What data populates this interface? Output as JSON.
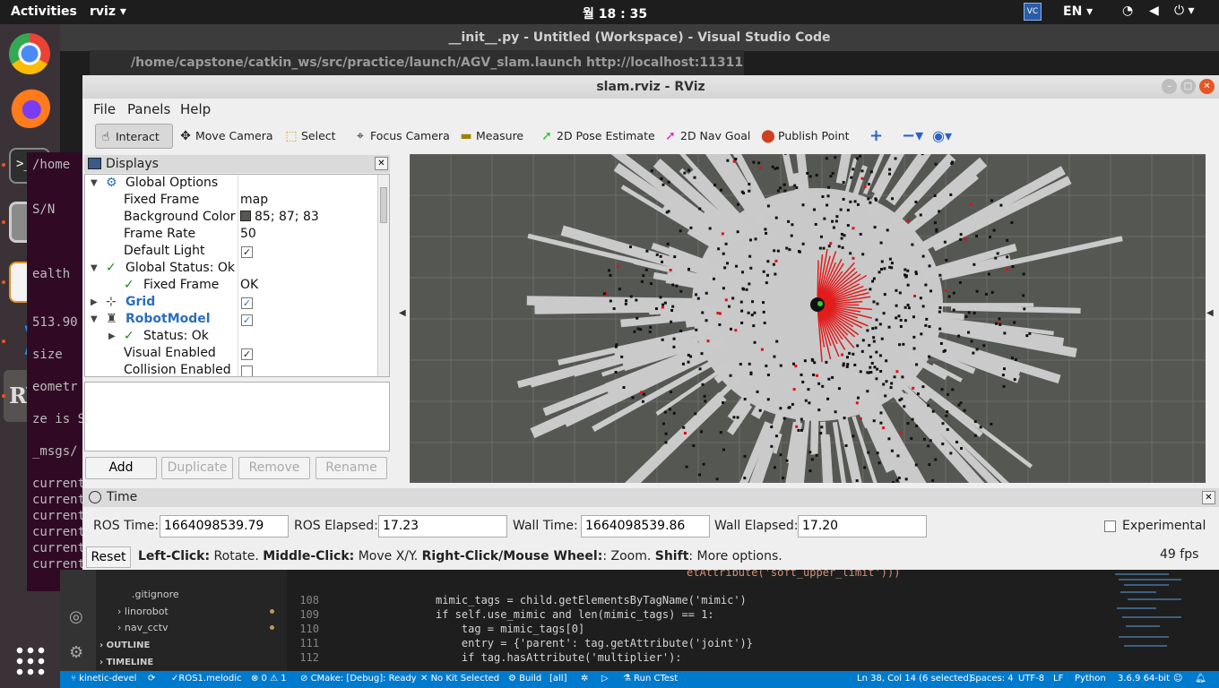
{
  "topbar": {
    "activities": "Activities",
    "app_menu": "rviz ▾",
    "clock": "월 18 : 35",
    "lang": "EN ▾"
  },
  "vscode": {
    "title": "__init__.py - Untitled (Workspace) - Visual Studio Code",
    "launch_window_title": "/home/capstone/catkin_ws/src/practice/launch/AGV_slam.launch http://localhost:11311",
    "terminal_lines": [
      "/home",
      "S/N",
      "ealth",
      "513.90",
      "size",
      "eometr",
      "ze is S",
      "_msgs/",
      "current",
      "current",
      "current",
      "current",
      "current",
      "current"
    ],
    "code_partial_top": "etAttribute('soft_upper_limit')))",
    "code_lines": [
      {
        "ln": "108",
        "text": "mimic_tags = child.getElementsByTagName('mimic')"
      },
      {
        "ln": "109",
        "text": "if self.use_mimic and len(mimic_tags) == 1:"
      },
      {
        "ln": "110",
        "text": "    tag = mimic_tags[0]"
      },
      {
        "ln": "111",
        "text": "    entry = {'parent': tag.getAttribute('joint')}"
      },
      {
        "ln": "112",
        "text": "    if tag.hasAttribute('multiplier'):"
      }
    ],
    "explorer": {
      "gitignore": ".gitignore",
      "linorobot": "linorobot",
      "nav_cctv": "nav_cctv",
      "outline": "OUTLINE",
      "timeline": "TIMELINE"
    },
    "status": {
      "branch": "kinetic-devel",
      "ros": "ROS1.melodic",
      "problems": "⊗ 0 ⚠ 1",
      "cmake": "CMake: [Debug]: Ready",
      "kit": "No Kit Selected",
      "build": "Build",
      "all": "[all]",
      "ctest": "Run CTest",
      "position": "Ln 38, Col 14 (6 selected)",
      "spaces": "Spaces: 4",
      "encoding": "UTF-8",
      "eol": "LF",
      "language": "Python",
      "interpreter": "3.6.9 64-bit"
    }
  },
  "rviz": {
    "title": "slam.rviz - RViz",
    "menu": {
      "file": "File",
      "panels": "Panels",
      "help": "Help"
    },
    "tools": {
      "interact": "Interact",
      "move_camera": "Move Camera",
      "select": "Select",
      "focus_camera": "Focus Camera",
      "measure": "Measure",
      "pose_estimate": "2D Pose Estimate",
      "nav_goal": "2D Nav Goal",
      "publish_point": "Publish Point"
    },
    "displays": {
      "title": "Displays",
      "rows": {
        "global_options": "Global Options",
        "fixed_frame": "Fixed Frame",
        "fixed_frame_val": "map",
        "bg_color": "Background Color",
        "bg_color_val": "85; 87; 83",
        "frame_rate": "Frame Rate",
        "frame_rate_val": "50",
        "default_light": "Default Light",
        "global_status": "Global Status: Ok",
        "status_fixed_frame": "Fixed Frame",
        "status_fixed_frame_val": "OK",
        "grid": "Grid",
        "robot_model": "RobotModel",
        "status_ok": "Status: Ok",
        "visual_enabled": "Visual Enabled",
        "collision_enabled": "Collision Enabled"
      },
      "buttons": {
        "add": "Add",
        "duplicate": "Duplicate",
        "remove": "Remove",
        "rename": "Rename"
      }
    },
    "background_color": "#555753",
    "time": {
      "title": "Time",
      "ros_time_label": "ROS Time:",
      "ros_time": "1664098539.79",
      "ros_elapsed_label": "ROS Elapsed:",
      "ros_elapsed": "17.23",
      "wall_time_label": "Wall Time:",
      "wall_time": "1664098539.86",
      "wall_elapsed_label": "Wall Elapsed:",
      "wall_elapsed": "17.20",
      "experimental": "Experimental",
      "reset": "Reset",
      "help_left_b": "Left-Click:",
      "help_left": " Rotate. ",
      "help_mid_b": "Middle-Click:",
      "help_mid": " Move X/Y. ",
      "help_right_b": "Right-Click/Mouse Wheel:",
      "help_right": ": Zoom. ",
      "help_shift_b": "Shift",
      "help_shift": ": More options.",
      "fps": "49 fps"
    }
  }
}
